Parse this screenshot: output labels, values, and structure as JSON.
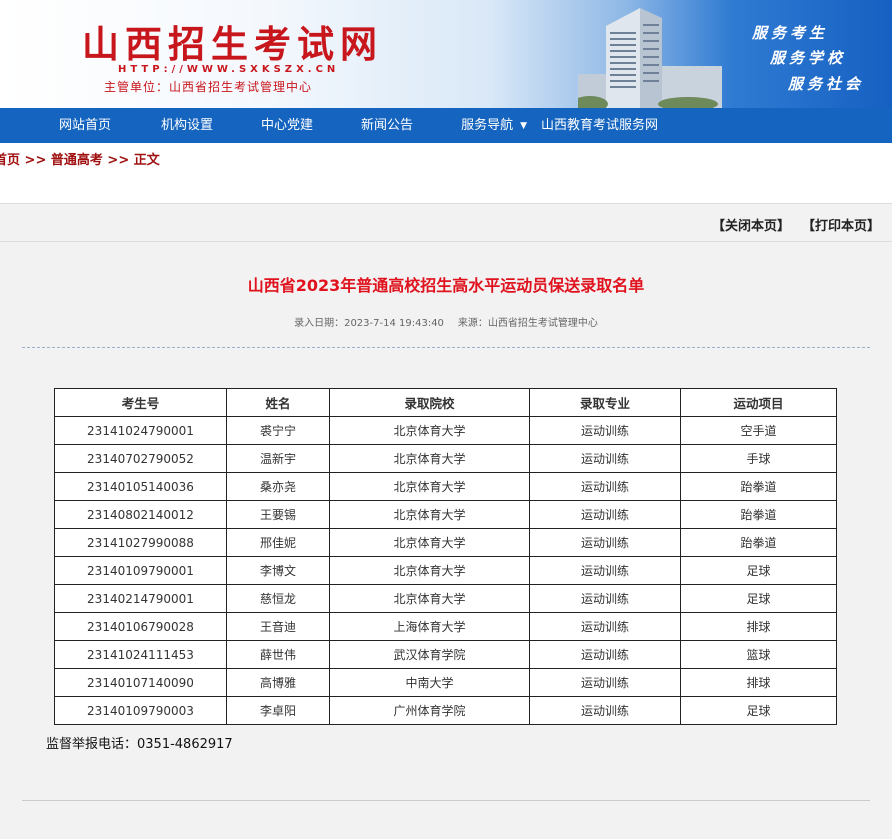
{
  "header": {
    "title": "山西招生考试网",
    "url": "HTTP://WWW.SXKSZX.CN",
    "sponsor": "主管单位：山西省招生考试管理中心",
    "slogans": [
      "服务考生",
      "服务学校",
      "服务社会"
    ]
  },
  "nav": {
    "items": [
      "网站首页",
      "机构设置",
      "中心党建",
      "新闻公告",
      "服务导航",
      "山西教育考试服务网"
    ]
  },
  "breadcrumb": {
    "home": "首页",
    "sep": ">>",
    "category": "普通高考",
    "current": "正文"
  },
  "actions": {
    "close": "【关闭本页】",
    "print": "【打印本页】"
  },
  "article": {
    "title": "山西省2023年普通高校招生高水平运动员保送录取名单",
    "date": "录入日期：2023-7-14 19:43:40",
    "source": "来源：山西省招生考试管理中心"
  },
  "table": {
    "headers": [
      "考生号",
      "姓名",
      "录取院校",
      "录取专业",
      "运动项目"
    ],
    "rows": [
      [
        "23141024790001",
        "裘宁宁",
        "北京体育大学",
        "运动训练",
        "空手道"
      ],
      [
        "23140702790052",
        "温新宇",
        "北京体育大学",
        "运动训练",
        "手球"
      ],
      [
        "23140105140036",
        "桑亦尧",
        "北京体育大学",
        "运动训练",
        "跆拳道"
      ],
      [
        "23140802140012",
        "王要锡",
        "北京体育大学",
        "运动训练",
        "跆拳道"
      ],
      [
        "23141027990088",
        "邢佳妮",
        "北京体育大学",
        "运动训练",
        "跆拳道"
      ],
      [
        "23140109790001",
        "李博文",
        "北京体育大学",
        "运动训练",
        "足球"
      ],
      [
        "23140214790001",
        "慈恒龙",
        "北京体育大学",
        "运动训练",
        "足球"
      ],
      [
        "23140106790028",
        "王音迪",
        "上海体育大学",
        "运动训练",
        "排球"
      ],
      [
        "23141024111453",
        "薛世伟",
        "武汉体育学院",
        "运动训练",
        "篮球"
      ],
      [
        "23140107140090",
        "高博雅",
        "中南大学",
        "运动训练",
        "排球"
      ],
      [
        "23140109790003",
        "李卓阳",
        "广州体育学院",
        "运动训练",
        "足球"
      ]
    ]
  },
  "report": "监督举报电话：0351-4862917"
}
